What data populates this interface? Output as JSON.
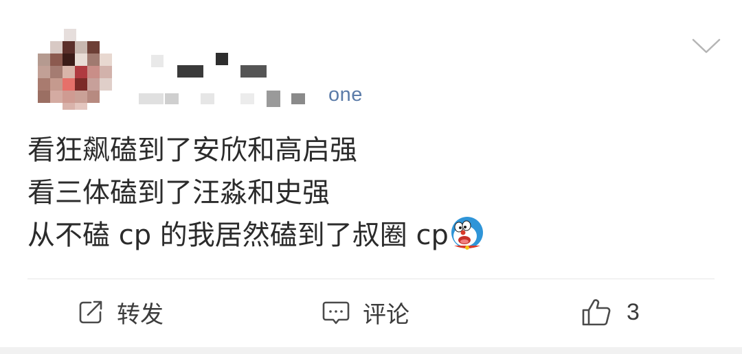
{
  "post": {
    "device": "one",
    "lines": [
      "看狂飙磕到了安欣和高启强",
      "看三体磕到了汪淼和史强",
      "从不磕 cp 的我居然磕到了叔圈 cp"
    ],
    "emoji": "doraemon-emoji"
  },
  "actions": {
    "repost_label": "转发",
    "comment_label": "评论",
    "like_count": "3"
  },
  "colors": {
    "device_text": "#5b7ba8",
    "body_text": "#2b2b2b",
    "action_text": "#3c3c3c",
    "divider": "#e6e6e6",
    "background": "#ffffff",
    "footer_strip": "#f1f1f1"
  },
  "icons": [
    "chevron-down-icon",
    "repost-icon",
    "comment-icon",
    "like-icon"
  ]
}
